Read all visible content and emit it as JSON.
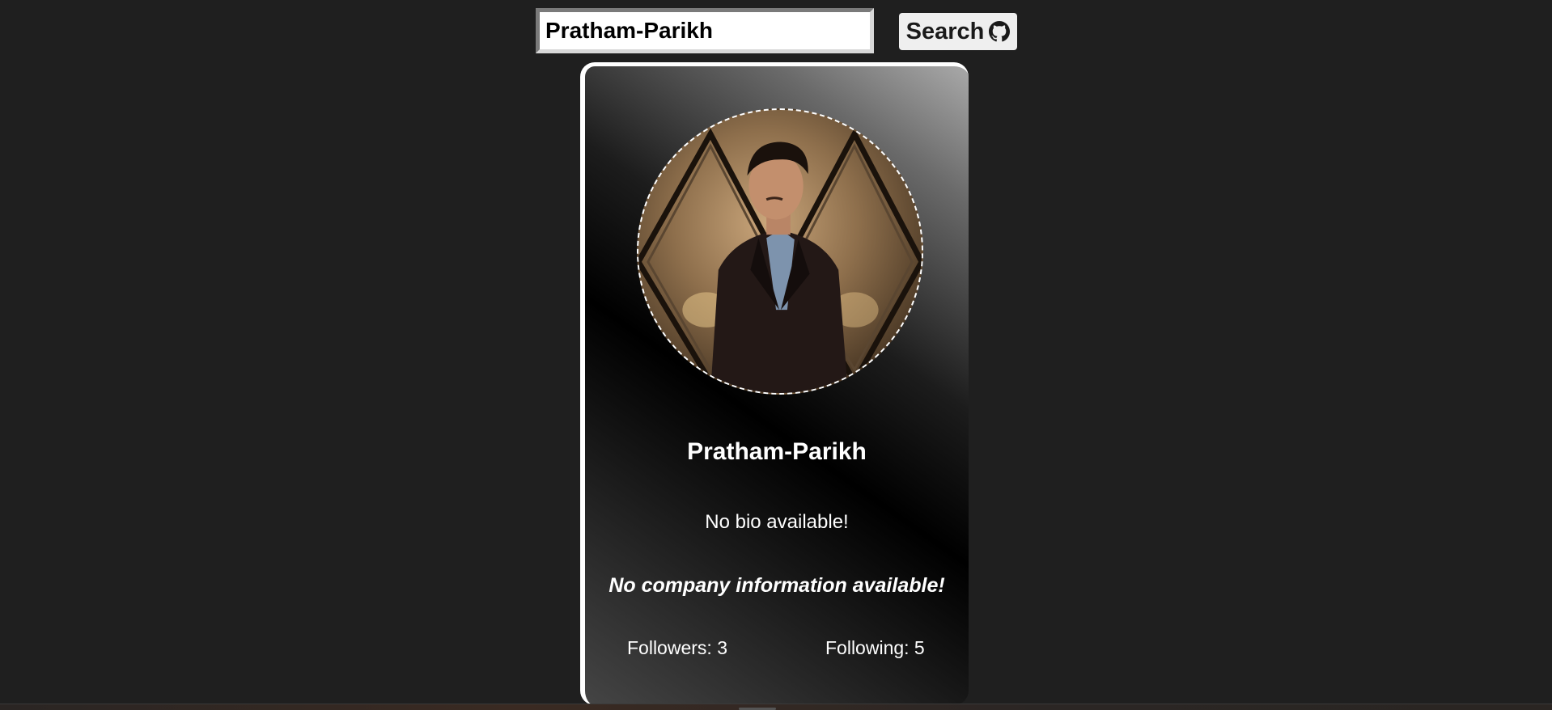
{
  "search": {
    "value": "Pratham-Parikh",
    "button_label": "Search",
    "button_icon": "github-icon"
  },
  "profile": {
    "name": "Pratham-Parikh",
    "bio": "No bio available!",
    "company": "No company information available!",
    "followers_text": "Followers: 3",
    "following_text": "Following: 5",
    "followers": 3,
    "following": 5
  },
  "colors": {
    "background": "#1f1f1f",
    "card_border": "#ffffff",
    "text": "#ffffff"
  }
}
